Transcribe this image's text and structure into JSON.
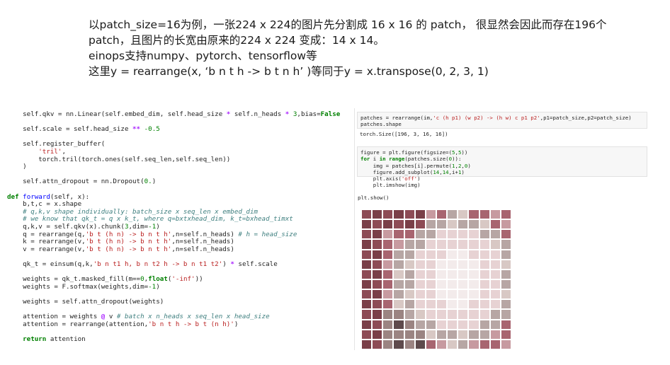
{
  "notes": [
    "以patch_size=16为例，一张224 x 224的图片先分割成 16 x 16 的 patch， 很显然会因此而存在196个",
    "patch，且图片的长宽由原来的224  x 224 变成：14  x 14。",
    "einops支持numpy、pytorch、tensorflow等",
    "这里y = rearrange(x,  ‘b n t h -> b t n h’ )等同于y = x.transpose(0, 2, 3, 1)"
  ],
  "left_code": [
    [
      [
        "    self.qkv = nn.Linear(self.embed_dim, self.head_size ",
        ""
      ],
      [
        "*",
        "op"
      ],
      [
        " self.n_heads ",
        ""
      ],
      [
        "*",
        "op"
      ],
      [
        " ",
        ""
      ],
      [
        "3",
        "num"
      ],
      [
        ",bias=",
        ""
      ],
      [
        "False",
        "kw"
      ]
    ],
    [
      [
        "",
        ""
      ]
    ],
    [
      [
        "    self.scale = self.head_size ",
        ""
      ],
      [
        "**",
        "op"
      ],
      [
        " ",
        ""
      ],
      [
        "-0.5",
        "num"
      ]
    ],
    [
      [
        "",
        ""
      ]
    ],
    [
      [
        "    self.register_buffer(",
        ""
      ]
    ],
    [
      [
        "        ",
        ""
      ],
      [
        "'tril'",
        "str"
      ],
      [
        ",",
        ""
      ]
    ],
    [
      [
        "        torch.tril(torch.ones(self.seq_len,self.seq_len))",
        ""
      ]
    ],
    [
      [
        "    )",
        ""
      ]
    ],
    [
      [
        "",
        ""
      ]
    ],
    [
      [
        "    self.attn_dropout = nn.Dropout(",
        ""
      ],
      [
        "0.",
        "num"
      ],
      [
        ")",
        ""
      ]
    ],
    [
      [
        "",
        ""
      ]
    ],
    [
      [
        "def",
        "kw"
      ],
      [
        " ",
        ""
      ],
      [
        "forward",
        "fn"
      ],
      [
        "(self, x):",
        ""
      ]
    ],
    [
      [
        "    b,t,c = x.shape",
        ""
      ]
    ],
    [
      [
        "    ",
        ""
      ],
      [
        "# q,k,v shape individually: batch_size x seq_len x embed_dim",
        "cm"
      ]
    ],
    [
      [
        "    ",
        ""
      ],
      [
        "# we know that qk_t = q x k_t, where q=bxtxhead_dim, k_t=bxhead_timxt",
        "cm"
      ]
    ],
    [
      [
        "    q,k,v = self.qkv(x).chunk(",
        ""
      ],
      [
        "3",
        "num"
      ],
      [
        ",dim=",
        ""
      ],
      [
        "-1",
        "num"
      ],
      [
        ")",
        ""
      ]
    ],
    [
      [
        "    q = rearrange(q,",
        ""
      ],
      [
        "'b t (h n) -> b n t h'",
        "str"
      ],
      [
        ",n=self.n_heads) ",
        ""
      ],
      [
        "# h = head_size",
        "cm"
      ]
    ],
    [
      [
        "    k = rearrange(v,",
        ""
      ],
      [
        "'b t (h n) -> b n t h'",
        "str"
      ],
      [
        ",n=self.n_heads)",
        ""
      ]
    ],
    [
      [
        "    v = rearrange(v,",
        ""
      ],
      [
        "'b t (h n) -> b n t h'",
        "str"
      ],
      [
        ",n=self.n_heads)",
        ""
      ]
    ],
    [
      [
        "",
        ""
      ]
    ],
    [
      [
        "    qk_t = einsum(q,k,",
        ""
      ],
      [
        "'b n t1 h, b n t2 h -> b n t1 t2'",
        "str"
      ],
      [
        ") ",
        ""
      ],
      [
        "*",
        "op"
      ],
      [
        " self.scale",
        ""
      ]
    ],
    [
      [
        "",
        ""
      ]
    ],
    [
      [
        "    weights = qk_t.masked_fill(m==",
        ""
      ],
      [
        "0",
        "num"
      ],
      [
        ",",
        ""
      ],
      [
        "float",
        "kw"
      ],
      [
        "(",
        ""
      ],
      [
        "'-inf'",
        "str"
      ],
      [
        "))",
        ""
      ]
    ],
    [
      [
        "    weights = F.softmax(weights,dim=",
        ""
      ],
      [
        "-1",
        "num"
      ],
      [
        ")",
        ""
      ]
    ],
    [
      [
        "",
        ""
      ]
    ],
    [
      [
        "    weights = self.attn_dropout(weights)",
        ""
      ]
    ],
    [
      [
        "",
        ""
      ]
    ],
    [
      [
        "    attention = weights ",
        ""
      ],
      [
        "@",
        "op"
      ],
      [
        " v ",
        ""
      ],
      [
        "# batch x n_heads x seq_len x head_size",
        "cm"
      ]
    ],
    [
      [
        "    attention = rearrange(attention,",
        ""
      ],
      [
        "'b n t h -> b t (n h)'",
        "str"
      ],
      [
        ")",
        ""
      ]
    ],
    [
      [
        "",
        ""
      ]
    ],
    [
      [
        "    ",
        ""
      ],
      [
        "return",
        "kw"
      ],
      [
        " attention",
        ""
      ]
    ]
  ],
  "right": {
    "cell1": [
      [
        [
          "patches = rearrange(im,",
          ""
        ],
        [
          "'c (h p1) (w p2) -> (h w) c p1 p2'",
          "str"
        ],
        [
          ",p1=patch_size,p2=patch_size)",
          ""
        ]
      ],
      [
        [
          "patches.shape",
          ""
        ]
      ]
    ],
    "out1": "torch.Size([196, 3, 16, 16])",
    "cell2": [
      [
        [
          "figure = plt.figure(figsize=(",
          ""
        ],
        [
          "5",
          "num"
        ],
        [
          ",",
          ""
        ],
        [
          "5",
          "num"
        ],
        [
          "))",
          ""
        ]
      ],
      [
        [
          "for",
          "kw"
        ],
        [
          " i ",
          ""
        ],
        [
          "in",
          "kw"
        ],
        [
          " ",
          ""
        ],
        [
          "range",
          "kw"
        ],
        [
          "(patches.size(",
          ""
        ],
        [
          "0",
          "num"
        ],
        [
          ")):",
          ""
        ]
      ],
      [
        [
          "    img = patches[i].permute(",
          ""
        ],
        [
          "1",
          "num"
        ],
        [
          ",",
          ""
        ],
        [
          "2",
          "num"
        ],
        [
          ",",
          ""
        ],
        [
          "0",
          "num"
        ],
        [
          ")",
          ""
        ]
      ],
      [
        [
          "    figure.add_subplot(",
          ""
        ],
        [
          "14",
          "num"
        ],
        [
          ",",
          ""
        ],
        [
          "14",
          "num"
        ],
        [
          ",i+",
          ""
        ],
        [
          "1",
          "num"
        ],
        [
          ")",
          ""
        ]
      ],
      [
        [
          "    plt.axis(",
          ""
        ],
        [
          "'off'",
          "str"
        ],
        [
          ")",
          ""
        ]
      ],
      [
        [
          "    plt.imshow(img)",
          ""
        ]
      ]
    ],
    "out2": "plt.show()"
  },
  "patch_grid": {
    "rows": 14,
    "cols": 14,
    "palette": [
      "#7a3f48",
      "#8d4b55",
      "#a86570",
      "#c79aa0",
      "#e7d2d3",
      "#f3ebeb",
      "#5e4a4c",
      "#b7a6a4",
      "#d8c8c4",
      "#9b8482"
    ]
  }
}
